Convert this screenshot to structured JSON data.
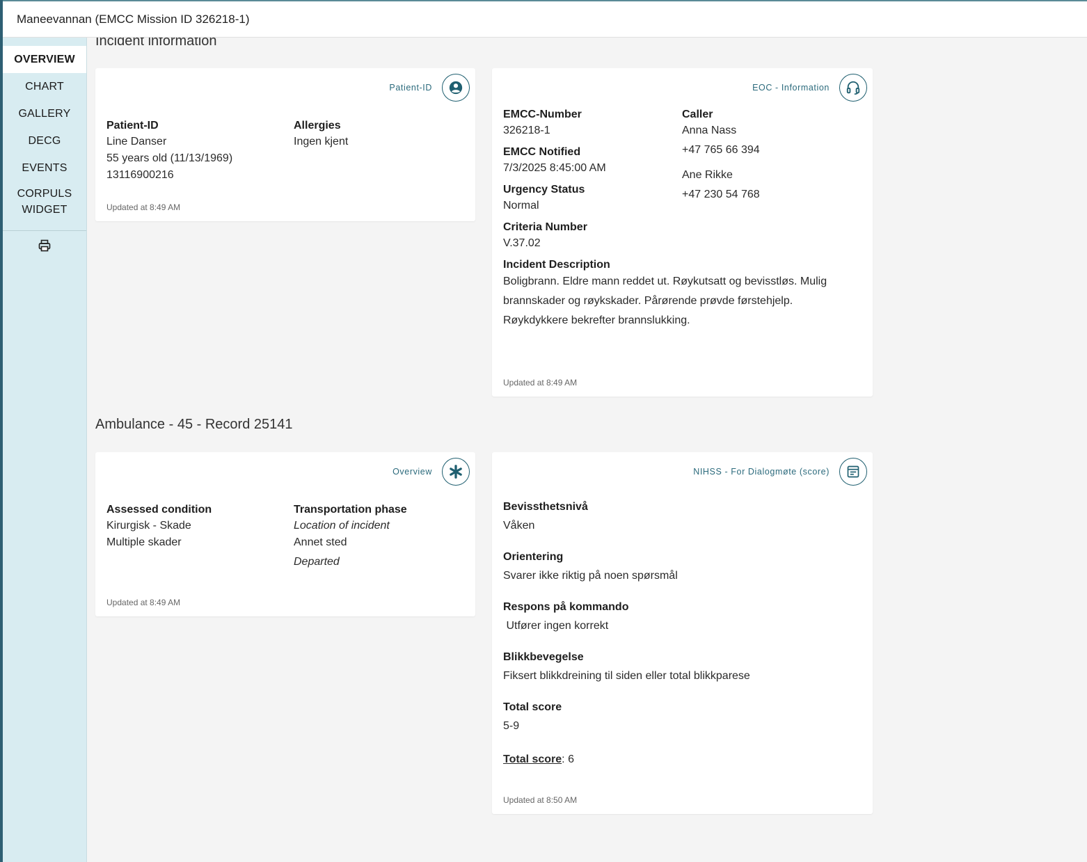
{
  "window": {
    "title": "Maneevannan (EMCC Mission ID 326218-1)"
  },
  "sidebar": {
    "items": [
      "OVERVIEW",
      "CHART",
      "GALLERY",
      "DECG",
      "EVENTS"
    ],
    "widget_line1": "CORPULS",
    "widget_line2": "WIDGET"
  },
  "incident": {
    "section_title": "Incident information",
    "patient_card": {
      "tag": "Patient-ID",
      "id_label": "Patient-ID",
      "name": "Line Danser",
      "age": "55 years old (11/13/1969)",
      "number": "13116900216",
      "allergies_label": "Allergies",
      "allergies": "Ingen kjent",
      "updated": "Updated at 8:49 AM"
    },
    "eoc_card": {
      "tag": "EOC - Information",
      "emcc_number_label": "EMCC-Number",
      "emcc_number": "326218-1",
      "emcc_notified_label": "EMCC Notified",
      "emcc_notified": "7/3/2025 8:45:00 AM",
      "urgency_label": "Urgency Status",
      "urgency": "Normal",
      "criteria_label": "Criteria Number",
      "criteria": "V.37.02",
      "description_label": "Incident Description",
      "description": "Boligbrann. Eldre mann reddet ut. Røykutsatt og bevisstløs. Mulig brannskader og røykskader. Pårørende prøvde førstehjelp. Røykdykkere bekrefter brannslukking.",
      "caller_label": "Caller",
      "caller1_name": "Anna Nass",
      "caller1_phone": "+47 765 66 394",
      "caller2_name": "Ane Rikke",
      "caller2_phone": "+47 230 54 768",
      "updated": "Updated at 8:49 AM"
    }
  },
  "ambulance": {
    "section_title": "Ambulance - 45 - Record 25141",
    "overview_card": {
      "tag": "Overview",
      "condition_label": "Assessed condition",
      "condition1": "Kirurgisk - Skade",
      "condition2": "Multiple skader",
      "phase_label": "Transportation phase",
      "phase_location": "Location of incident",
      "phase_place": "Annet sted",
      "phase_status": "Departed",
      "updated": "Updated at 8:49 AM"
    },
    "nihss_card": {
      "tag": "NIHSS - For Dialogmøte (score)",
      "items": [
        {
          "label": "Bevissthetsnivå",
          "value": "Våken"
        },
        {
          "label": "Orientering",
          "value": "Svarer ikke riktig på noen spørsmål"
        },
        {
          "label": "Respons på kommando",
          "value": " Utfører ingen korrekt"
        },
        {
          "label": "Blikkbevegelse",
          "value": "Fiksert blikkdreining til siden eller total blikkparese"
        },
        {
          "label": "Total score",
          "value": "5-9"
        }
      ],
      "total_label": "Total score",
      "total_value": ": 6",
      "updated": "Updated at 8:50 AM"
    }
  },
  "icons": [
    "user-circle-icon",
    "headset-icon",
    "asterisk-icon",
    "form-icon",
    "printer-icon"
  ]
}
